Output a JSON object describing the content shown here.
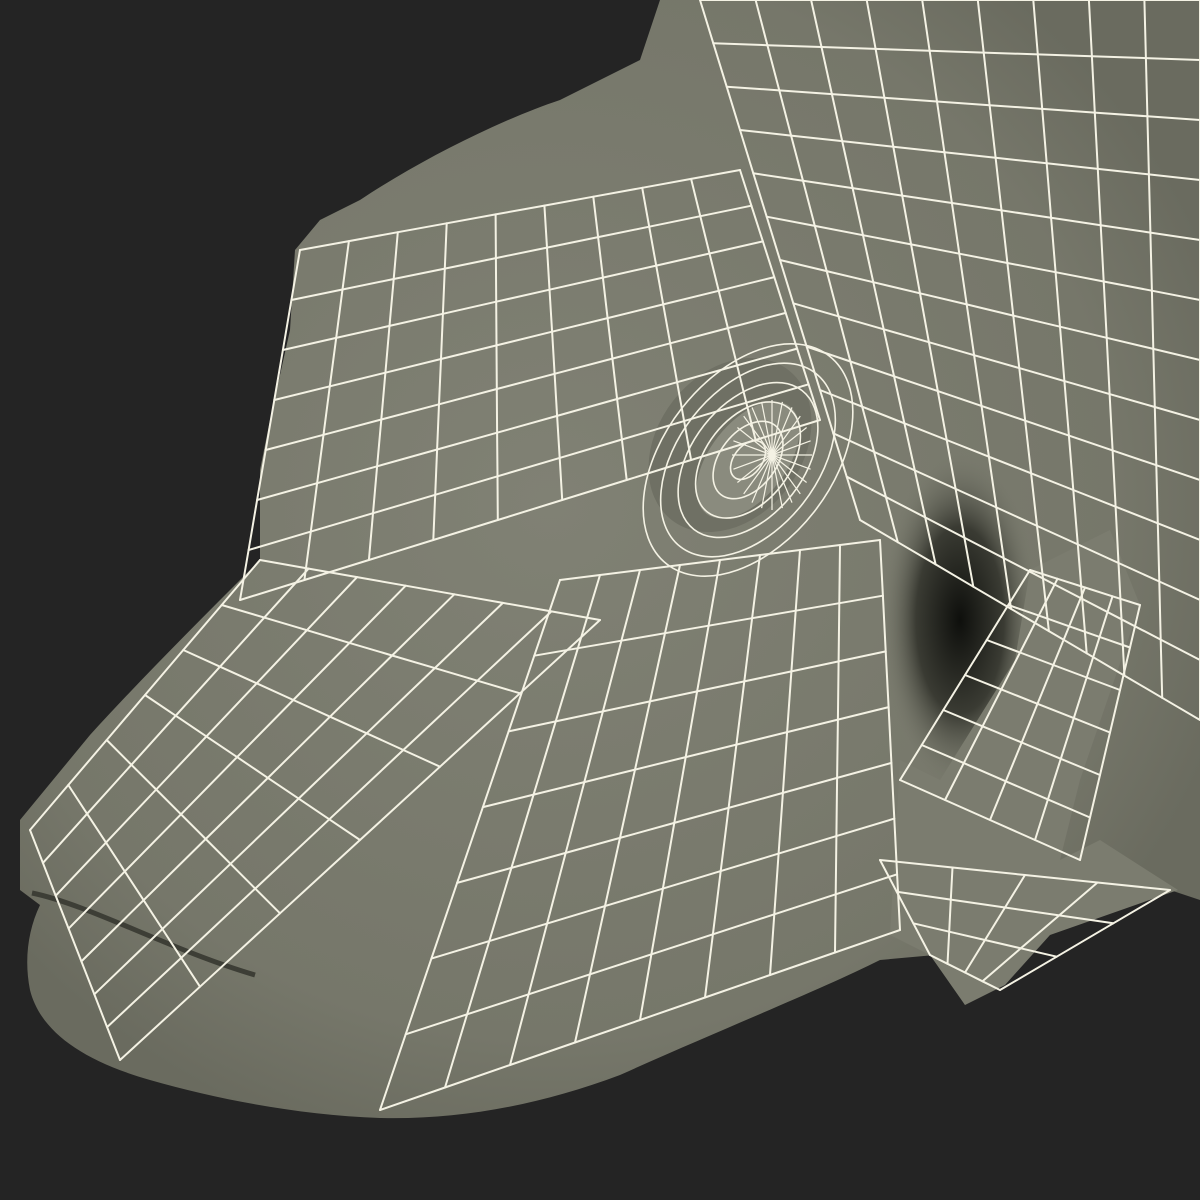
{
  "scene": {
    "background_color": "#242424",
    "mesh_fill_color": "#7a7b6e",
    "mesh_shadow_color": "#2b2c27",
    "wire_color": "#f4f2e4",
    "subject": "fish-head-wireframe-render"
  }
}
